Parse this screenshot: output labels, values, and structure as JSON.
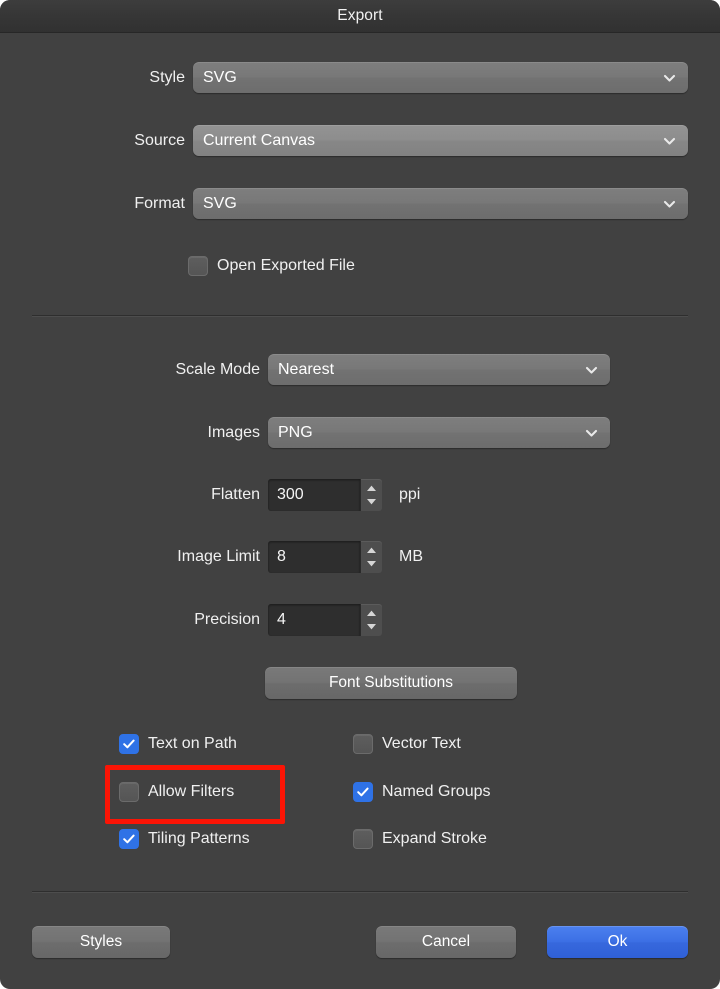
{
  "window": {
    "title": "Export",
    "accent_blue": "#2f72e6",
    "ok_button_blue": "#3c6fe4",
    "background": "#414141",
    "titlebar_background": "#363636",
    "highlight_color": "#fb1405"
  },
  "fields": {
    "style": {
      "label": "Style",
      "value": "SVG",
      "icon": "chevron-down-icon"
    },
    "source": {
      "label": "Source",
      "value": "Current Canvas",
      "icon": "chevron-down-icon"
    },
    "format": {
      "label": "Format",
      "value": "SVG",
      "icon": "chevron-down-icon"
    },
    "scale_mode": {
      "label": "Scale Mode",
      "value": "Nearest",
      "icon": "chevron-down-icon"
    },
    "images": {
      "label": "Images",
      "value": "PNG",
      "icon": "chevron-down-icon"
    },
    "flatten": {
      "label": "Flatten",
      "value": "300",
      "unit": "ppi"
    },
    "image_limit": {
      "label": "Image Limit",
      "value": "8",
      "unit": "MB"
    },
    "precision": {
      "label": "Precision",
      "value": "4",
      "unit": ""
    }
  },
  "checkboxes": {
    "open_exported_file": {
      "label": "Open Exported File",
      "checked": false
    },
    "text_on_path": {
      "label": "Text on Path",
      "checked": true
    },
    "allow_filters": {
      "label": "Allow Filters",
      "checked": false,
      "highlighted": true
    },
    "tiling_patterns": {
      "label": "Tiling Patterns",
      "checked": true
    },
    "vector_text": {
      "label": "Vector Text",
      "checked": false
    },
    "named_groups": {
      "label": "Named Groups",
      "checked": true
    },
    "expand_stroke": {
      "label": "Expand Stroke",
      "checked": false
    }
  },
  "buttons": {
    "font_substitutions": "Font Substitutions",
    "styles": "Styles",
    "cancel": "Cancel",
    "ok": "Ok"
  }
}
